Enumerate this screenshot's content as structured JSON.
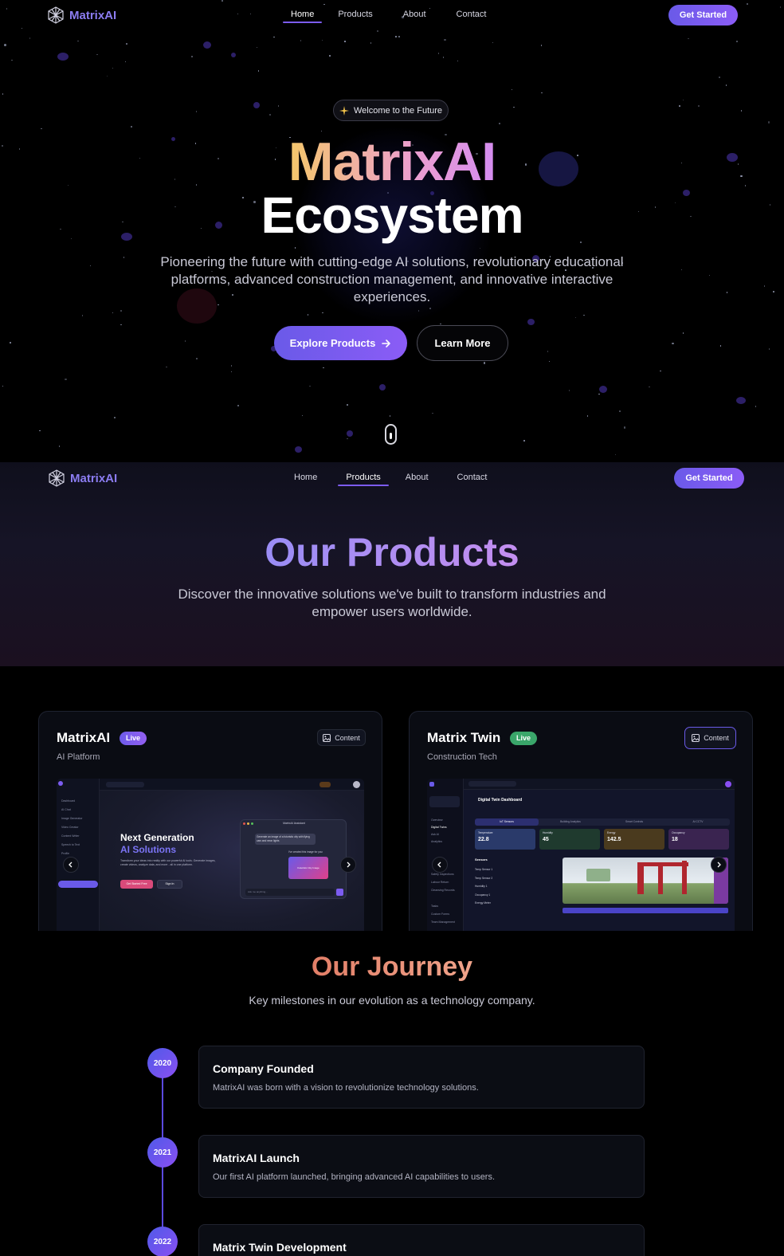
{
  "brand": {
    "name": "MatrixAI",
    "accent": "#8b7cf0"
  },
  "nav": {
    "links": [
      "Home",
      "Products",
      "About",
      "Contact"
    ],
    "cta": "Get Started"
  },
  "hero": {
    "badge": "Welcome to the Future",
    "title_line1": "MatrixAI",
    "title_line2": "Ecosystem",
    "subtitle": "Pioneering the future with cutting-edge AI solutions, revolutionary educational platforms, advanced construction management, and innovative interactive experiences.",
    "explore_label": "Explore Products",
    "learn_label": "Learn More"
  },
  "products_header": {
    "title": "Our Products",
    "subtitle": "Discover the innovative solutions we've built to transform industries and empower users worldwide."
  },
  "products": [
    {
      "name": "MatrixAI",
      "status": "Live",
      "category": "AI Platform",
      "content_label": "Content",
      "preview": {
        "headline1": "Next Generation",
        "headline2": "AI Solutions",
        "text": "Transform your ideas into reality with our powerful AI tools. Generate images, create videos, analyze data, and more - all in one platform.",
        "primary": "Get Started Free",
        "secondary": "Sign In",
        "sidebar": [
          "Dashboard",
          "AI Chat",
          "Image Generator",
          "Video Creator",
          "Content Writer",
          "Speech to Text",
          "Profile"
        ],
        "chat_title": "MatrixAI Assistant",
        "chat_prompt": "Generate an image of a futuristic city with flying cars and neon lights",
        "chat_reply": "I've created this image for you:",
        "chat_image": "Futuristic City Image",
        "chat_input": "Ask me anything..."
      }
    },
    {
      "name": "Matrix Twin",
      "status": "Live",
      "category": "Construction Tech",
      "content_label": "Content",
      "preview": {
        "title": "Digital Twin Dashboard",
        "tabs": [
          "IoT Sensors",
          "Building Analytics",
          "Smart Controls",
          "AI CCTV"
        ],
        "kpis": [
          {
            "label": "Temperature",
            "value": "22.8",
            "color": "#2a3a6a"
          },
          {
            "label": "Humidity",
            "value": "45",
            "color": "#1f3a2e"
          },
          {
            "label": "Energy",
            "value": "142.5",
            "color": "#4a3a1e"
          },
          {
            "label": "Occupancy",
            "value": "18",
            "color": "#3a2450"
          }
        ],
        "sensors_label": "Sensors",
        "sensors": [
          "Temp Sensor 1",
          "Temp Sensor 2",
          "Humidity 1",
          "Occupancy 1",
          "Energy Meter"
        ],
        "sidebar": [
          "Overview",
          "Digital Twins",
          "Ask AI",
          "Analytics",
          "Safety Inspections",
          "Labour Return",
          "Cleansing Records",
          "Tasks",
          "Custom Forms",
          "Team Management"
        ]
      }
    }
  ],
  "journey": {
    "title": "Our Journey",
    "subtitle": "Key milestones in our evolution as a technology company.",
    "milestones": [
      {
        "year": "2020",
        "title": "Company Founded",
        "text": "MatrixAI was born with a vision to revolutionize technology solutions."
      },
      {
        "year": "2021",
        "title": "MatrixAI Launch",
        "text": "Our first AI platform launched, bringing advanced AI capabilities to users."
      },
      {
        "year": "2022",
        "title": "Matrix Twin Development",
        "text": ""
      }
    ]
  }
}
